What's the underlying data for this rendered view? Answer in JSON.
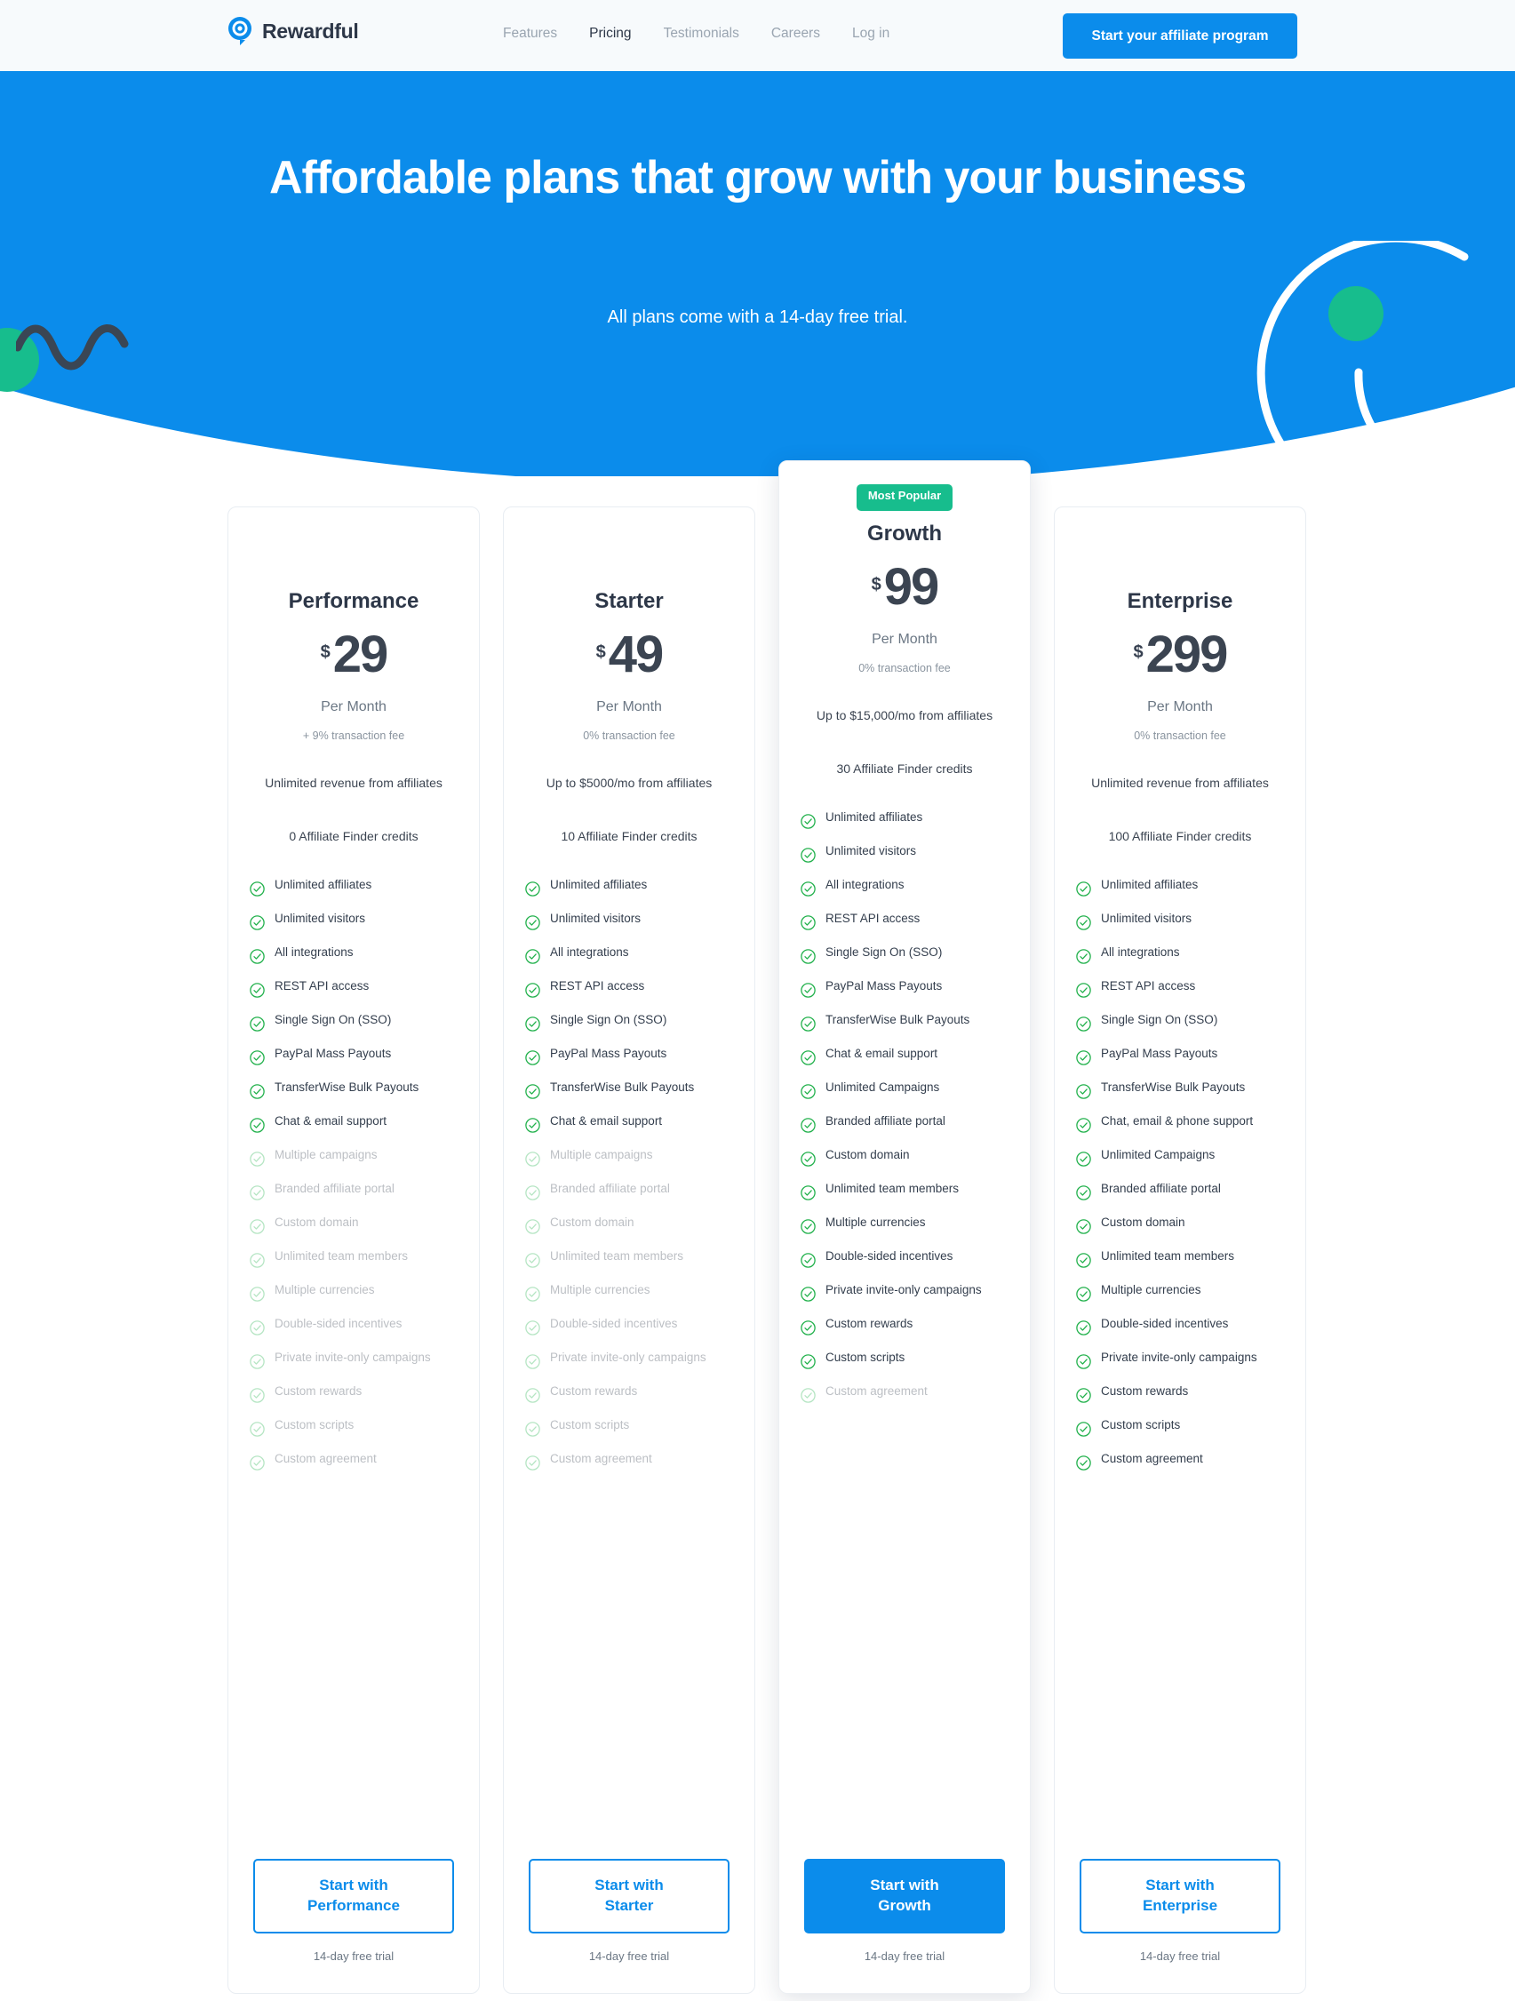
{
  "nav": {
    "logo_text": "Rewardful",
    "logo_icon": "target-bullseye-icon",
    "links": [
      {
        "label": "Features",
        "active": false
      },
      {
        "label": "Pricing",
        "active": true
      },
      {
        "label": "Testimonials",
        "active": false
      },
      {
        "label": "Careers",
        "active": false
      },
      {
        "label": "Log in",
        "active": false
      }
    ],
    "cta_label": "Start your affiliate program"
  },
  "hero": {
    "title": "Affordable plans that grow with your business",
    "subtitle": "All plans come with a 14-day free trial.",
    "bg_color": "#0b8ceb",
    "accent_green": "#17bd8d"
  },
  "plans": [
    {
      "name": "Performance",
      "currency": "$",
      "amount": "29",
      "period": "Per Month",
      "fee": "+ 9% transaction fee",
      "revenue": "Unlimited revenue from affiliates",
      "credits": "0 Affiliate Finder credits",
      "featured": false,
      "badge": null,
      "cta_label": "Start with Performance",
      "cta_solid": false,
      "trial": "14-day free trial",
      "features": [
        {
          "label": "Unlimited affiliates",
          "on": true
        },
        {
          "label": "Unlimited visitors",
          "on": true
        },
        {
          "label": "All integrations",
          "on": true
        },
        {
          "label": "REST API access",
          "on": true
        },
        {
          "label": "Single Sign On (SSO)",
          "on": true
        },
        {
          "label": "PayPal Mass Payouts",
          "on": true
        },
        {
          "label": "TransferWise Bulk Payouts",
          "on": true
        },
        {
          "label": "Chat & email support",
          "on": true
        },
        {
          "label": "Multiple campaigns",
          "on": false
        },
        {
          "label": "Branded affiliate portal",
          "on": false
        },
        {
          "label": "Custom domain",
          "on": false
        },
        {
          "label": "Unlimited team members",
          "on": false
        },
        {
          "label": "Multiple currencies",
          "on": false
        },
        {
          "label": "Double-sided incentives",
          "on": false
        },
        {
          "label": "Private invite-only campaigns",
          "on": false
        },
        {
          "label": "Custom rewards",
          "on": false
        },
        {
          "label": "Custom scripts",
          "on": false
        },
        {
          "label": "Custom agreement",
          "on": false
        }
      ]
    },
    {
      "name": "Starter",
      "currency": "$",
      "amount": "49",
      "period": "Per Month",
      "fee": "0% transaction fee",
      "revenue": "Up to $5000/mo from affiliates",
      "credits": "10 Affiliate Finder credits",
      "featured": false,
      "badge": null,
      "cta_label": "Start with Starter",
      "cta_solid": false,
      "trial": "14-day free trial",
      "features": [
        {
          "label": "Unlimited affiliates",
          "on": true
        },
        {
          "label": "Unlimited visitors",
          "on": true
        },
        {
          "label": "All integrations",
          "on": true
        },
        {
          "label": "REST API access",
          "on": true
        },
        {
          "label": "Single Sign On (SSO)",
          "on": true
        },
        {
          "label": "PayPal Mass Payouts",
          "on": true
        },
        {
          "label": "TransferWise Bulk Payouts",
          "on": true
        },
        {
          "label": "Chat & email support",
          "on": true
        },
        {
          "label": "Multiple campaigns",
          "on": false
        },
        {
          "label": "Branded affiliate portal",
          "on": false
        },
        {
          "label": "Custom domain",
          "on": false
        },
        {
          "label": "Unlimited team members",
          "on": false
        },
        {
          "label": "Multiple currencies",
          "on": false
        },
        {
          "label": "Double-sided incentives",
          "on": false
        },
        {
          "label": "Private invite-only campaigns",
          "on": false
        },
        {
          "label": "Custom rewards",
          "on": false
        },
        {
          "label": "Custom scripts",
          "on": false
        },
        {
          "label": "Custom agreement",
          "on": false
        }
      ]
    },
    {
      "name": "Growth",
      "currency": "$",
      "amount": "99",
      "period": "Per Month",
      "fee": "0% transaction fee",
      "revenue": "Up to $15,000/mo from affiliates",
      "credits": "30 Affiliate Finder credits",
      "featured": true,
      "badge": "Most Popular",
      "cta_label": "Start with Growth",
      "cta_solid": true,
      "trial": "14-day free trial",
      "features": [
        {
          "label": "Unlimited affiliates",
          "on": true
        },
        {
          "label": "Unlimited visitors",
          "on": true
        },
        {
          "label": "All integrations",
          "on": true
        },
        {
          "label": "REST API access",
          "on": true
        },
        {
          "label": "Single Sign On (SSO)",
          "on": true
        },
        {
          "label": "PayPal Mass Payouts",
          "on": true
        },
        {
          "label": "TransferWise Bulk Payouts",
          "on": true
        },
        {
          "label": "Chat & email support",
          "on": true
        },
        {
          "label": "Unlimited Campaigns",
          "on": true
        },
        {
          "label": "Branded affiliate portal",
          "on": true
        },
        {
          "label": "Custom domain",
          "on": true
        },
        {
          "label": "Unlimited team members",
          "on": true
        },
        {
          "label": "Multiple currencies",
          "on": true
        },
        {
          "label": "Double-sided incentives",
          "on": true
        },
        {
          "label": "Private invite-only campaigns",
          "on": true
        },
        {
          "label": "Custom rewards",
          "on": true
        },
        {
          "label": "Custom scripts",
          "on": true
        },
        {
          "label": "Custom agreement",
          "on": false
        }
      ]
    },
    {
      "name": "Enterprise",
      "currency": "$",
      "amount": "299",
      "period": "Per Month",
      "fee": "0% transaction fee",
      "revenue": "Unlimited revenue from affiliates",
      "credits": "100 Affiliate Finder credits",
      "featured": false,
      "badge": null,
      "cta_label": "Start with Enterprise",
      "cta_solid": false,
      "trial": "14-day free trial",
      "features": [
        {
          "label": "Unlimited affiliates",
          "on": true
        },
        {
          "label": "Unlimited visitors",
          "on": true
        },
        {
          "label": "All integrations",
          "on": true
        },
        {
          "label": "REST API access",
          "on": true
        },
        {
          "label": "Single Sign On (SSO)",
          "on": true
        },
        {
          "label": "PayPal Mass Payouts",
          "on": true
        },
        {
          "label": "TransferWise Bulk Payouts",
          "on": true
        },
        {
          "label": "Chat, email & phone support",
          "on": true
        },
        {
          "label": "Unlimited Campaigns",
          "on": true
        },
        {
          "label": "Branded affiliate portal",
          "on": true
        },
        {
          "label": "Custom domain",
          "on": true
        },
        {
          "label": "Unlimited team members",
          "on": true
        },
        {
          "label": "Multiple currencies",
          "on": true
        },
        {
          "label": "Double-sided incentives",
          "on": true
        },
        {
          "label": "Private invite-only campaigns",
          "on": true
        },
        {
          "label": "Custom rewards",
          "on": true
        },
        {
          "label": "Custom scripts",
          "on": true
        },
        {
          "label": "Custom agreement",
          "on": true
        }
      ]
    }
  ]
}
